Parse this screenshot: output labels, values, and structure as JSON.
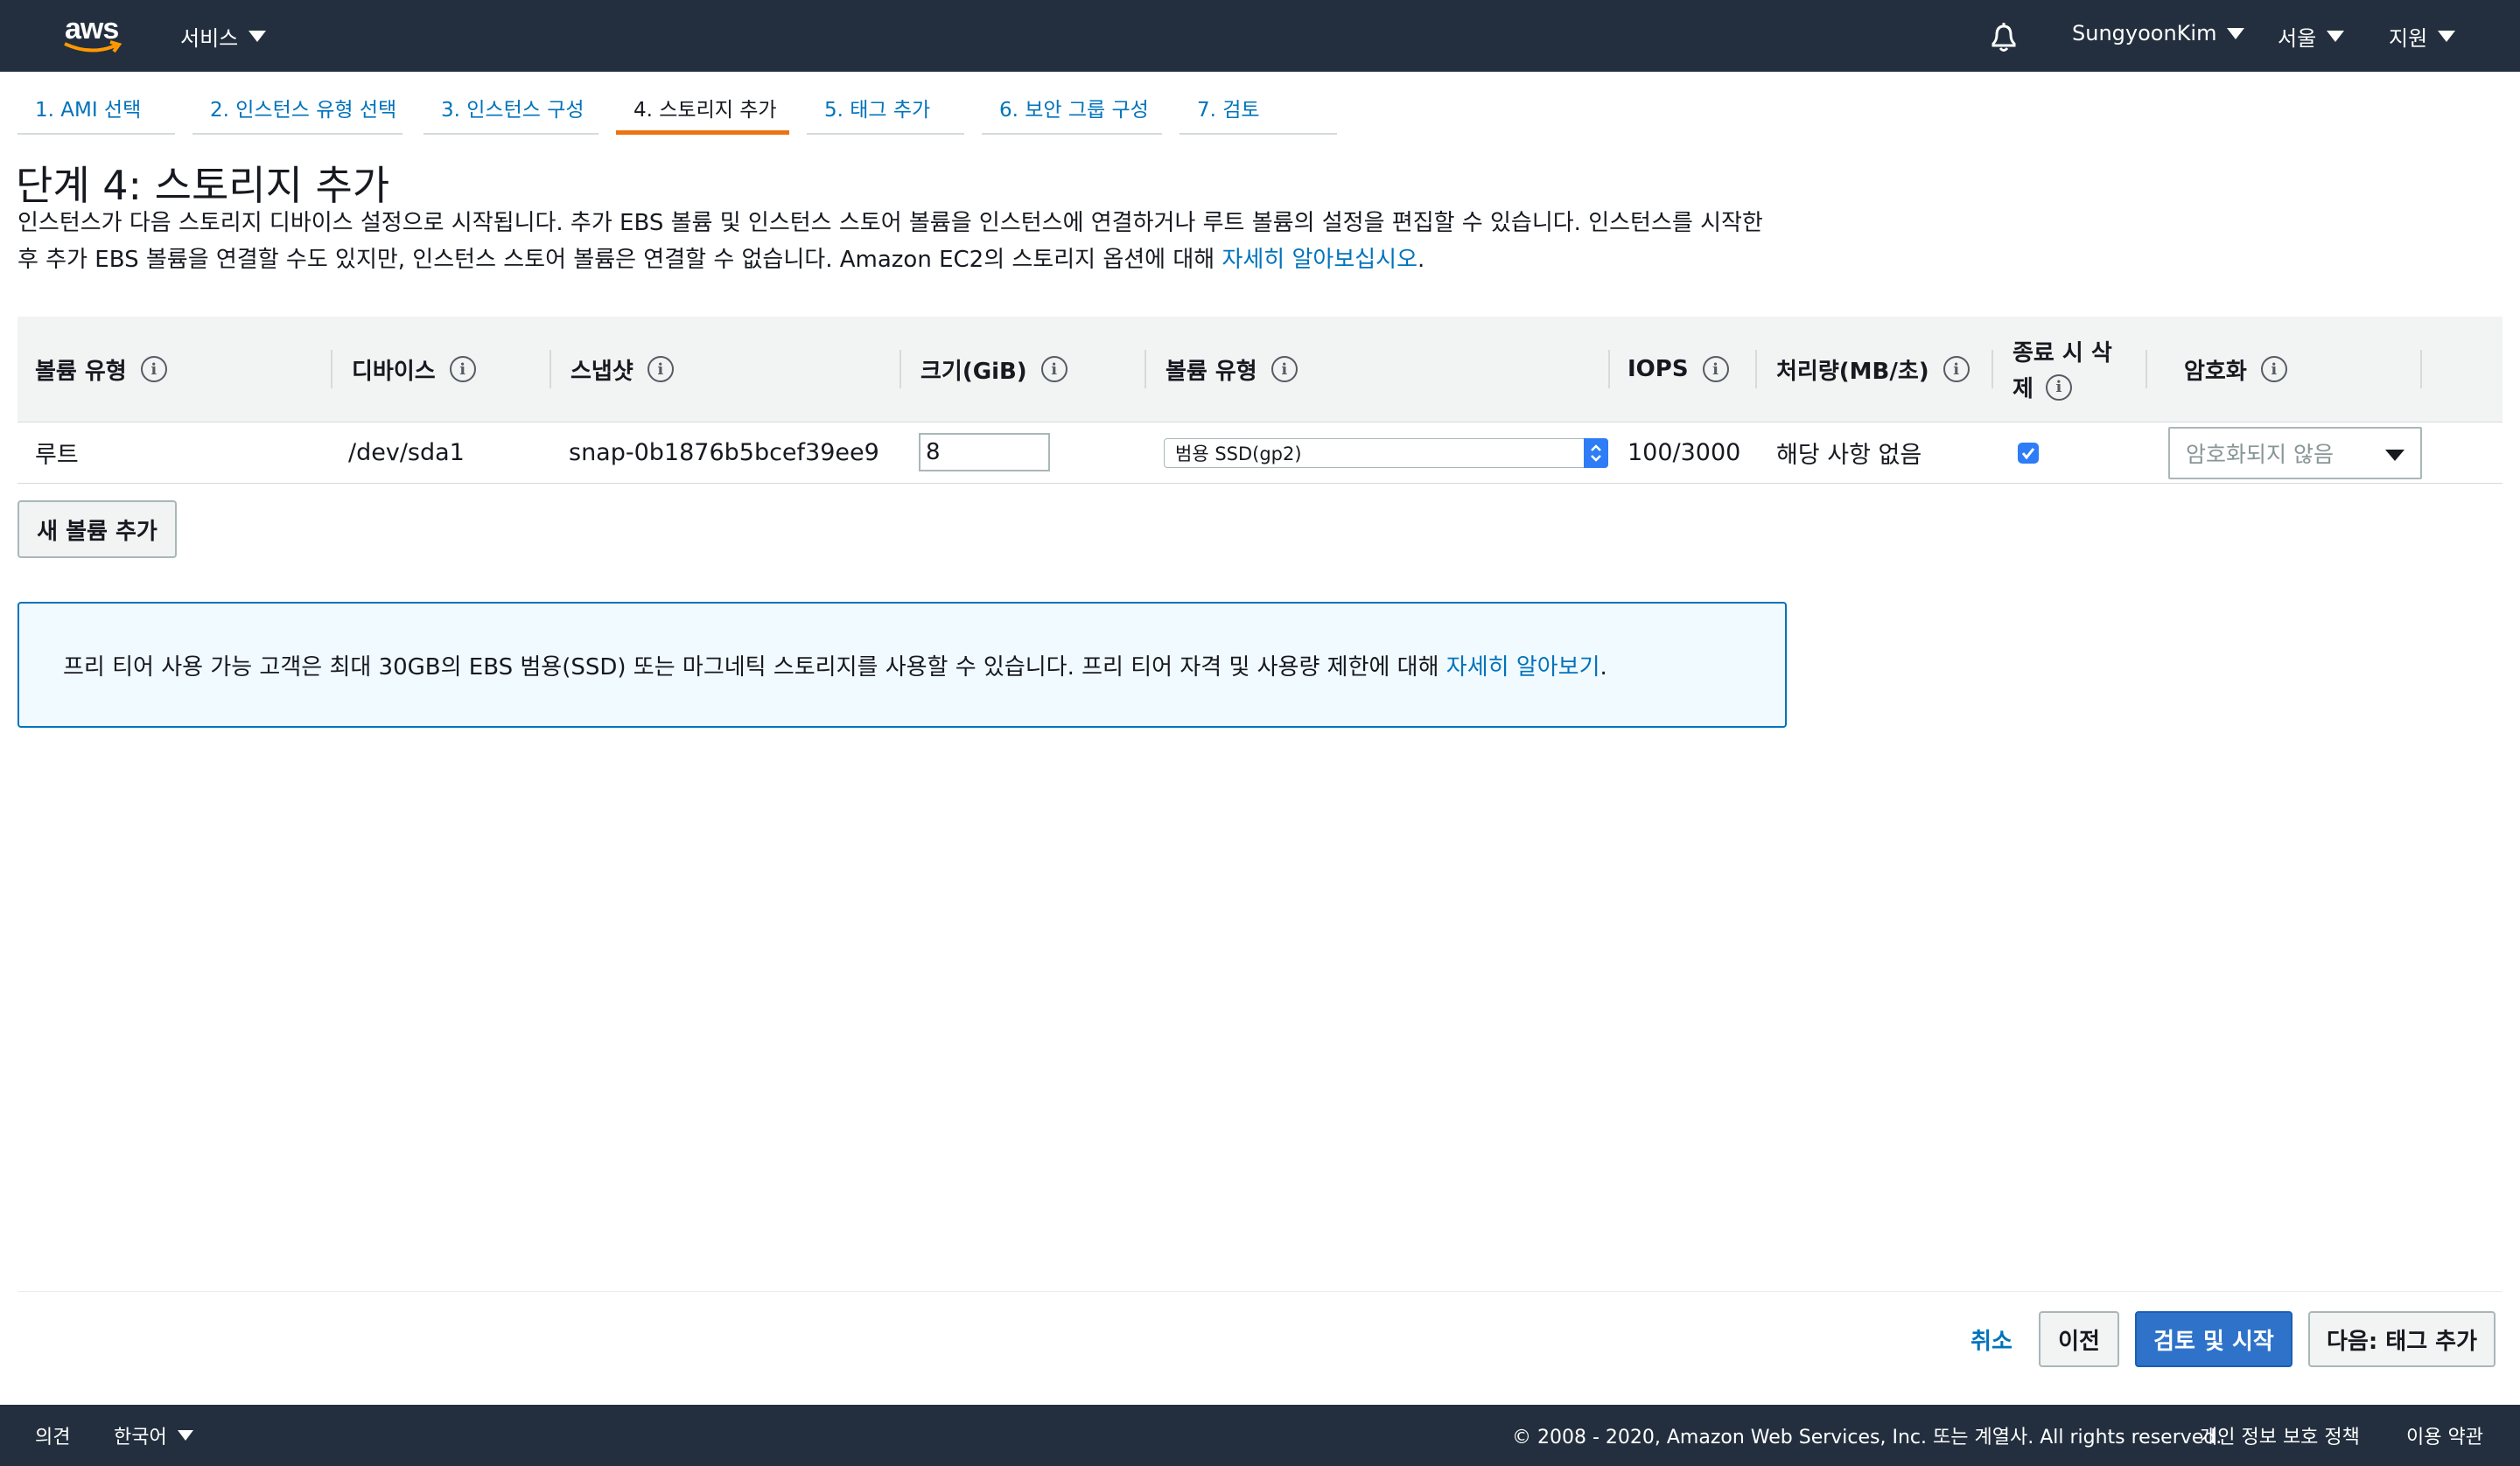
{
  "topnav": {
    "logo_text": "aws",
    "services": "서비스",
    "user": "SungyoonKim",
    "region": "서울",
    "support": "지원"
  },
  "tabs": [
    {
      "label": "1. AMI 선택"
    },
    {
      "label": "2. 인스턴스 유형 선택"
    },
    {
      "label": "3. 인스턴스 구성"
    },
    {
      "label": "4. 스토리지 추가"
    },
    {
      "label": "5. 태그 추가"
    },
    {
      "label": "6. 보안 그룹 구성"
    },
    {
      "label": "7. 검토"
    }
  ],
  "page": {
    "title": "단계 4: 스토리지 추가",
    "desc_line1": "인스턴스가 다음 스토리지 디바이스 설정으로 시작됩니다. 추가 EBS 볼륨 및 인스턴스 스토어 볼륨을 인스턴스에 연결하거나 루트 볼륨의 설정을 편집할 수 있습니다. 인스턴스를 시작한",
    "desc_line2": "후 추가 EBS 볼륨을 연결할 수도 있지만, 인스턴스 스토어 볼륨은 연결할 수 없습니다. Amazon EC2의 스토리지 옵션에 대해 ",
    "desc_link": "자세히 알아보십시오",
    "desc_end": "."
  },
  "table": {
    "headers": [
      "볼륨 유형",
      "디바이스",
      "스냅샷",
      "크기(GiB)",
      "볼륨 유형",
      "IOPS",
      "처리량(MB/초)",
      "종료 시 삭",
      "제",
      "암호화"
    ],
    "row": {
      "type": "루트",
      "device": "/dev/sda1",
      "snapshot": "snap-0b1876b5bcef39ee9",
      "size": "8",
      "volume_type": "범용 SSD(gp2)",
      "iops": "100/3000",
      "throughput": "해당 사항 없음",
      "delete_on_termination": true,
      "encryption": "암호화되지 않음"
    }
  },
  "add_volume": "새 볼륨 추가",
  "infobox": {
    "text": "프리 티어 사용 가능 고객은 최대 30GB의 EBS 범용(SSD) 또는 마그네틱 스토리지를 사용할 수 있습니다. 프리 티어 자격 및 사용량 제한에 대해 ",
    "link": "자세히 알아보기",
    "end": "."
  },
  "actions": {
    "cancel": "취소",
    "previous": "이전",
    "review": "검토 및 시작",
    "next": "다음: 태그 추가"
  },
  "footer": {
    "feedback": "의견",
    "language": "한국어",
    "copyright": "© 2008 - 2020, Amazon Web Services, Inc. 또는 계열사. All rights reserved.",
    "privacy": "개인 정보 보호 정책",
    "terms": "이용 약관"
  },
  "colors": {
    "nav": "#232f3e",
    "link": "#0073bb",
    "active_tab": "#ec7211",
    "primary": "#2e73c9"
  }
}
